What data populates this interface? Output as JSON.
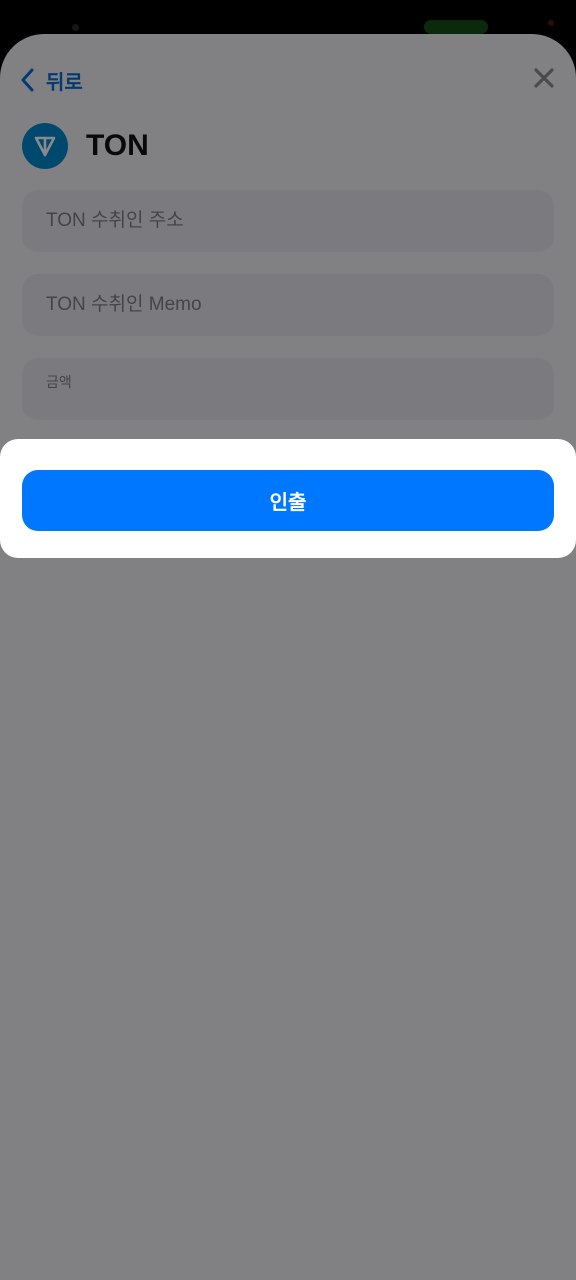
{
  "header": {
    "back_label": "뒤로",
    "close_icon": "close-icon",
    "back_icon": "chevron-left-icon"
  },
  "token": {
    "name": "TON",
    "logo_icon": "ton-logo-icon",
    "brand_color": "#0088cc"
  },
  "form": {
    "recipient_address_placeholder": "TON 수취인 주소",
    "recipient_memo_placeholder": "TON 수취인 Memo",
    "amount_label": "금액"
  },
  "actions": {
    "withdraw_label": "인출",
    "accent_color": "#0077ff"
  }
}
